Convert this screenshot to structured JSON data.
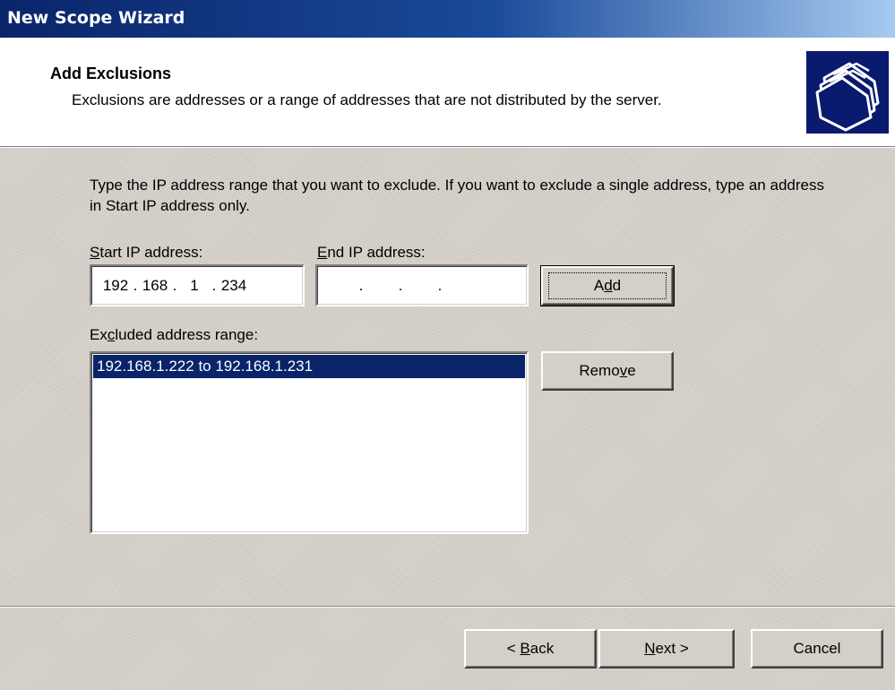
{
  "window": {
    "title": "New Scope Wizard"
  },
  "header": {
    "title": "Add Exclusions",
    "description": "Exclusions are addresses or a range of addresses that are not distributed by the server.",
    "icon": "folders-icon"
  },
  "instructions": "Type the IP address range that you want to exclude. If you want to exclude a single address, type an address in Start IP address only.",
  "start_ip": {
    "label_mnemonic": "S",
    "label_rest": "tart IP address:",
    "octets": [
      "192",
      "168",
      "1",
      "234"
    ]
  },
  "end_ip": {
    "label_mnemonic": "E",
    "label_rest": "nd IP address:",
    "octets": [
      "",
      "",
      "",
      ""
    ]
  },
  "add_button": {
    "pre": "A",
    "mnemonic": "d",
    "post": "d"
  },
  "excluded": {
    "label_pre": "Ex",
    "label_mnemonic": "c",
    "label_post": "luded address range:",
    "items": [
      "192.168.1.222 to 192.168.1.231"
    ]
  },
  "remove_button": {
    "pre": "Remo",
    "mnemonic": "v",
    "post": "e"
  },
  "footer": {
    "back": {
      "pre": "< ",
      "mnemonic": "B",
      "post": "ack"
    },
    "next": {
      "pre": "",
      "mnemonic": "N",
      "post": "ext >"
    },
    "cancel": "Cancel"
  }
}
